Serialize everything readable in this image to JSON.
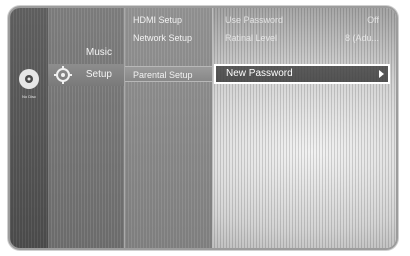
{
  "sidebar": {
    "disc_caption": "No Disc",
    "disc_icon": "disc-icon"
  },
  "menu": {
    "categories": [
      {
        "label": "Music"
      },
      {
        "label": "Setup",
        "icon": "setup-icon"
      }
    ],
    "setup_items": [
      {
        "label": "HDMI Setup"
      },
      {
        "label": "Network Setup"
      },
      {
        "label": "Parental Setup"
      }
    ]
  },
  "submenu": {
    "rows": [
      {
        "name": "Use Password",
        "value": "Off"
      },
      {
        "name": "Ratinal Level",
        "value": "8 (Adu..."
      }
    ],
    "selected": {
      "label": "New Password"
    }
  },
  "colors": {
    "highlight_border": "#ffffff",
    "text": "#f4f4f4"
  }
}
